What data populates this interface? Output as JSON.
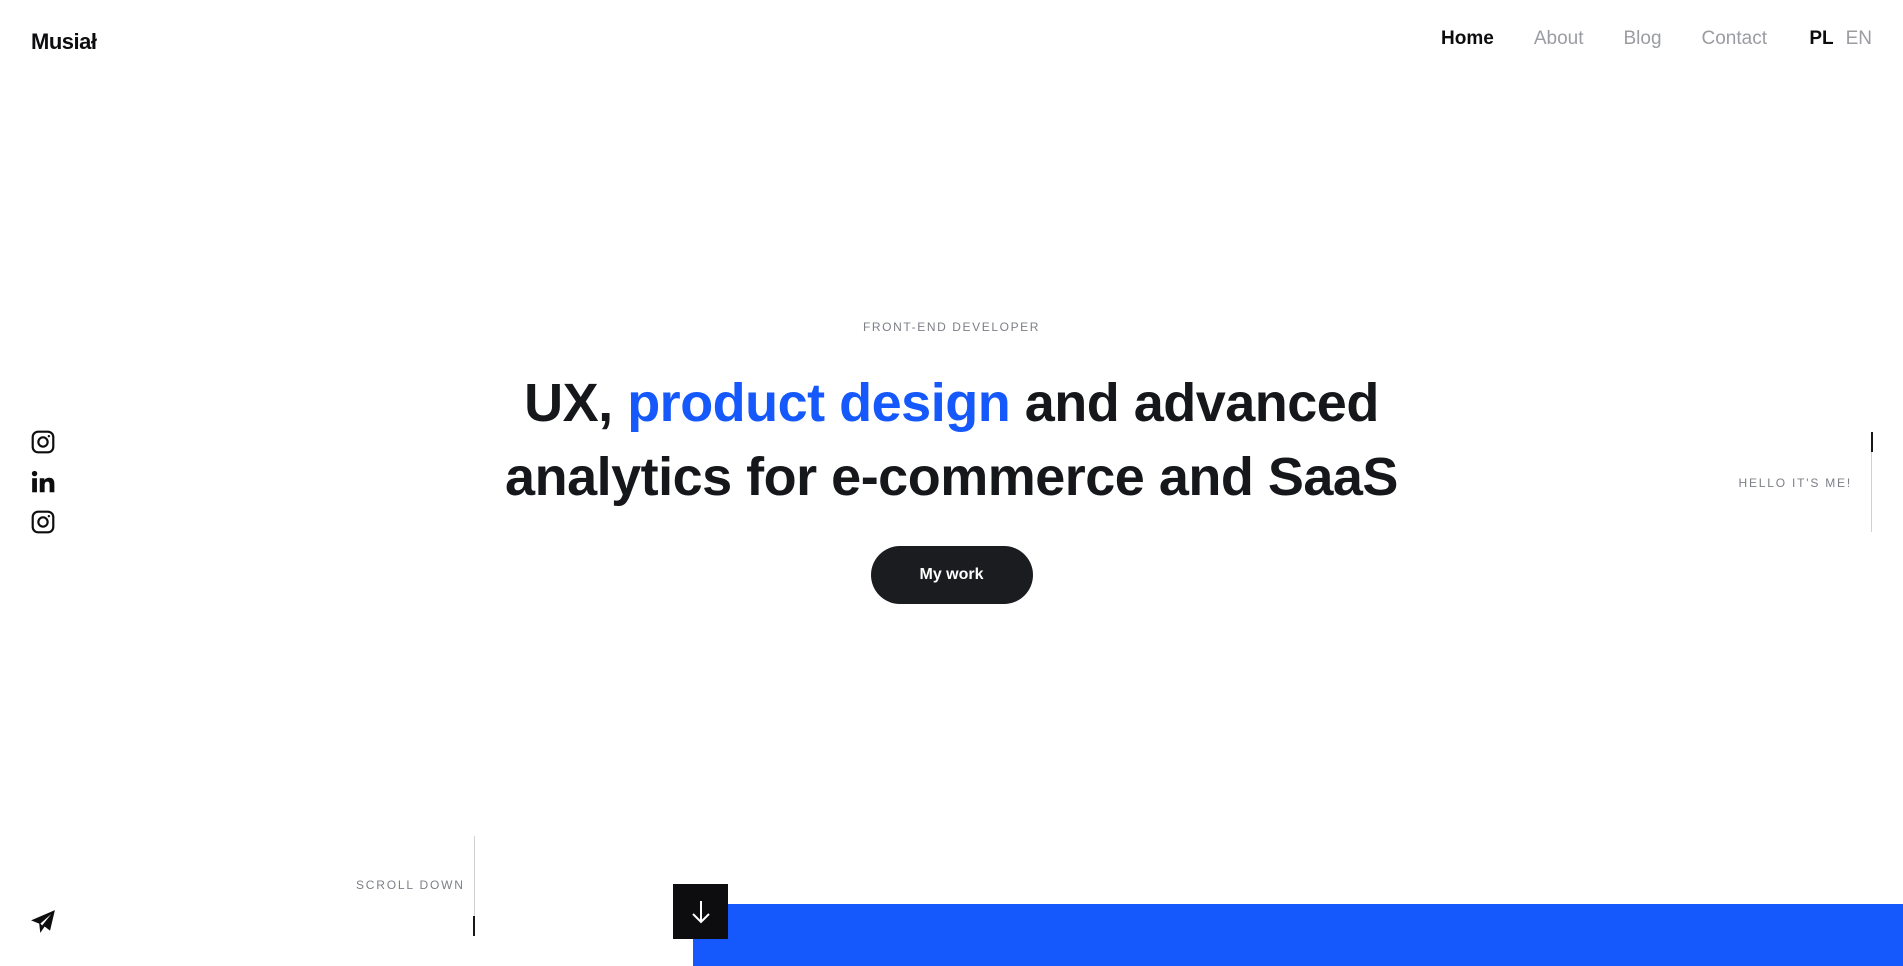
{
  "brand": {
    "logo": "Musiał"
  },
  "nav": {
    "items": [
      {
        "label": "Home",
        "active": true
      },
      {
        "label": "About",
        "active": false
      },
      {
        "label": "Blog",
        "active": false
      },
      {
        "label": "Contact",
        "active": false
      }
    ]
  },
  "lang": {
    "pl": "PL",
    "en": "EN",
    "active": "PL"
  },
  "social": {
    "icons": [
      "instagram-icon",
      "linkedin-icon",
      "instagram-icon"
    ]
  },
  "hero": {
    "eyebrow": "FRONT-END DEVELOPER",
    "headline_pre": "UX, ",
    "headline_accent": "product design",
    "headline_post_line1": " and advanced",
    "headline_line2": "analytics for e-commerce and SaaS",
    "cta_label": "My work"
  },
  "side": {
    "hello": "HELLO IT'S ME!"
  },
  "scroll": {
    "label": "SCROLL DOWN"
  },
  "icons": {
    "scroll_button": "arrow-down-icon",
    "contact": "paper-plane-icon"
  },
  "colors": {
    "accent": "#1558fb",
    "dark": "#1b1c20",
    "muted": "#9a9ca2"
  }
}
